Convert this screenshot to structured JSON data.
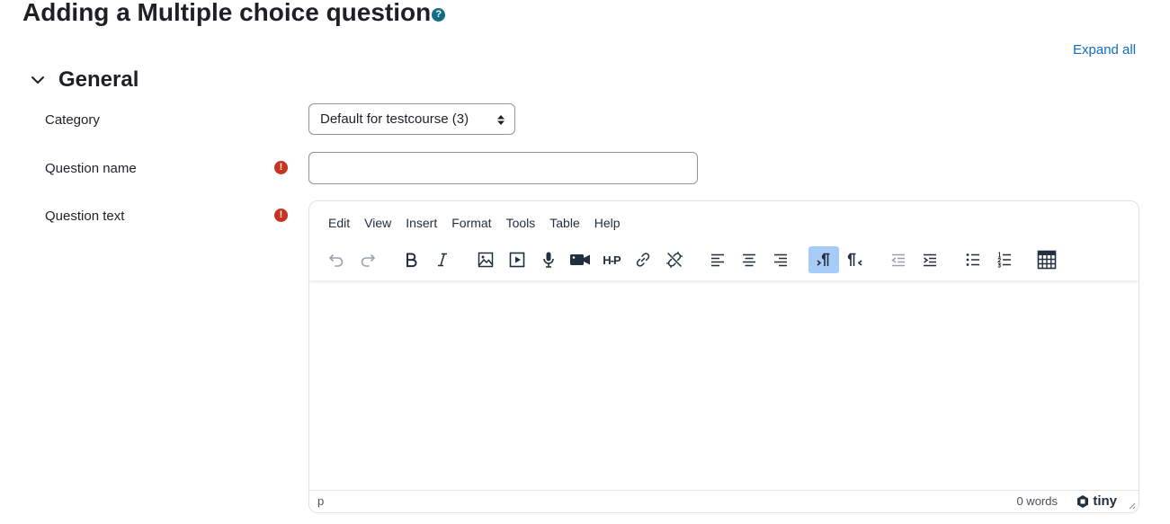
{
  "page": {
    "title": "Adding a Multiple choice question",
    "help_icon_symbol": "?",
    "expand_all": "Expand all"
  },
  "section": {
    "title": "General",
    "expanded": true
  },
  "fields": {
    "category": {
      "label": "Category",
      "selected": "Default for testcourse (3)"
    },
    "question_name": {
      "label": "Question name",
      "value": "",
      "required_symbol": "!"
    },
    "question_text": {
      "label": "Question text",
      "required_symbol": "!"
    }
  },
  "editor": {
    "menu": [
      "Edit",
      "View",
      "Insert",
      "Format",
      "Tools",
      "Table",
      "Help"
    ],
    "toolbar_icons": [
      "undo-icon",
      "redo-icon",
      "bold-icon",
      "italic-icon",
      "image-icon",
      "media-icon",
      "record-audio-icon",
      "record-video-icon",
      "h5p-icon",
      "link-icon",
      "unlink-icon",
      "align-left-icon",
      "align-center-icon",
      "align-right-icon",
      "ltr-icon",
      "rtl-icon",
      "outdent-icon",
      "indent-icon",
      "bullet-list-icon",
      "numbered-list-icon",
      "calculator-icon"
    ],
    "h5p_label": "H-P",
    "status_path": "p",
    "word_count": "0 words",
    "brand": "tiny"
  },
  "colors": {
    "link": "#0f6cbf",
    "help": "#0f6e84",
    "required": "#ca3120",
    "active_button": "#a6ccf7"
  }
}
